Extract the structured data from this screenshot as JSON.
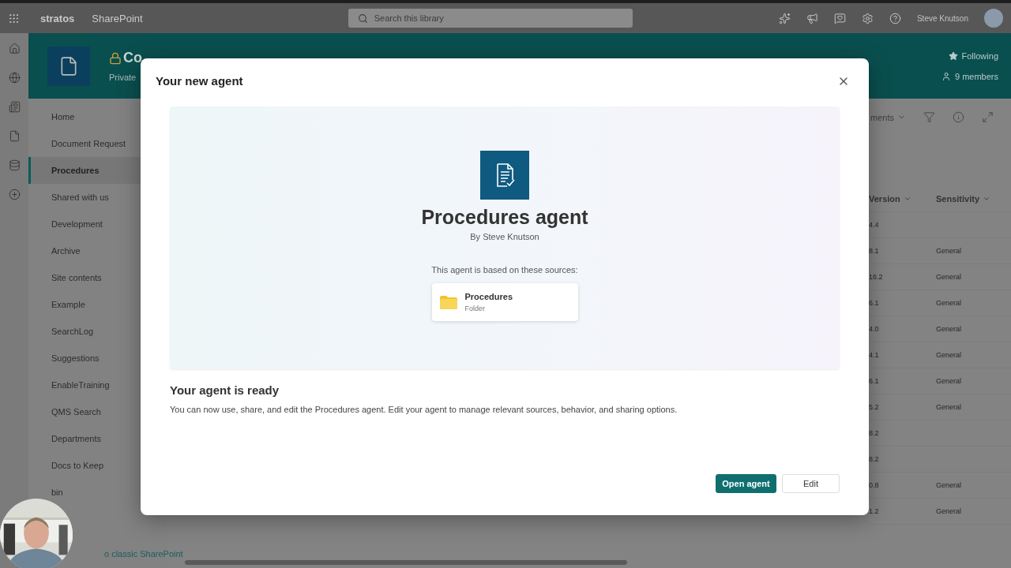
{
  "top_bar": {
    "brand": "stratos",
    "app": "SharePoint",
    "search": {
      "placeholder": "Search this library"
    },
    "user": "Steve Knutson"
  },
  "site": {
    "title": "Co",
    "subtitle": "Private",
    "following": "Following",
    "members": "9 members"
  },
  "nav": {
    "items": [
      {
        "label": "Home",
        "selected": false
      },
      {
        "label": "Document Request",
        "selected": false
      },
      {
        "label": "Procedures",
        "selected": true
      },
      {
        "label": "Shared with us",
        "selected": false
      },
      {
        "label": "Development",
        "selected": false
      },
      {
        "label": "Archive",
        "selected": false
      },
      {
        "label": "Site contents",
        "selected": false
      },
      {
        "label": "Example",
        "selected": false
      },
      {
        "label": "SearchLog",
        "selected": false
      },
      {
        "label": "Suggestions",
        "selected": false
      },
      {
        "label": "EnableTraining",
        "selected": false
      },
      {
        "label": "QMS Search",
        "selected": false
      },
      {
        "label": "Departments",
        "selected": false
      },
      {
        "label": "Docs to Keep",
        "selected": false
      },
      {
        "label": "bin",
        "selected": false
      }
    ],
    "footer_link": "o classic SharePoint"
  },
  "command_bar": {
    "view": "ments"
  },
  "table": {
    "columns": [
      "Version",
      "Sensitivity"
    ],
    "rows": [
      {
        "version": "4.4"
      },
      {
        "version": "8.1",
        "sensitivity": "General"
      },
      {
        "version": "16.2",
        "sensitivity": "General"
      },
      {
        "version": "6.1",
        "sensitivity": "General"
      },
      {
        "version": "4.0",
        "sensitivity": "General"
      },
      {
        "version": "4.1",
        "sensitivity": "General"
      },
      {
        "version": "6.1",
        "sensitivity": "General"
      },
      {
        "version": "5.2",
        "sensitivity": "General"
      },
      {
        "version": "8.2"
      },
      {
        "version": "8.2"
      },
      {
        "version": "0.8",
        "sensitivity": "General"
      },
      {
        "version": "1.2",
        "sensitivity": "General"
      }
    ]
  },
  "dialog": {
    "title": "Your new agent",
    "agent_name": "Procedures agent",
    "author": "By Steve Knutson",
    "sources_label": "This agent is based on these sources:",
    "sources": [
      {
        "name": "Procedures",
        "type": "Folder"
      }
    ],
    "ready_heading": "Your agent is ready",
    "ready_text": "You can now use, share, and edit the Procedures agent. Edit your agent to manage relevant sources, behavior, and sharing options.",
    "buttons": [
      {
        "label": "Open agent",
        "kind": "primary"
      },
      {
        "label": "Edit",
        "kind": "secondary"
      }
    ]
  }
}
